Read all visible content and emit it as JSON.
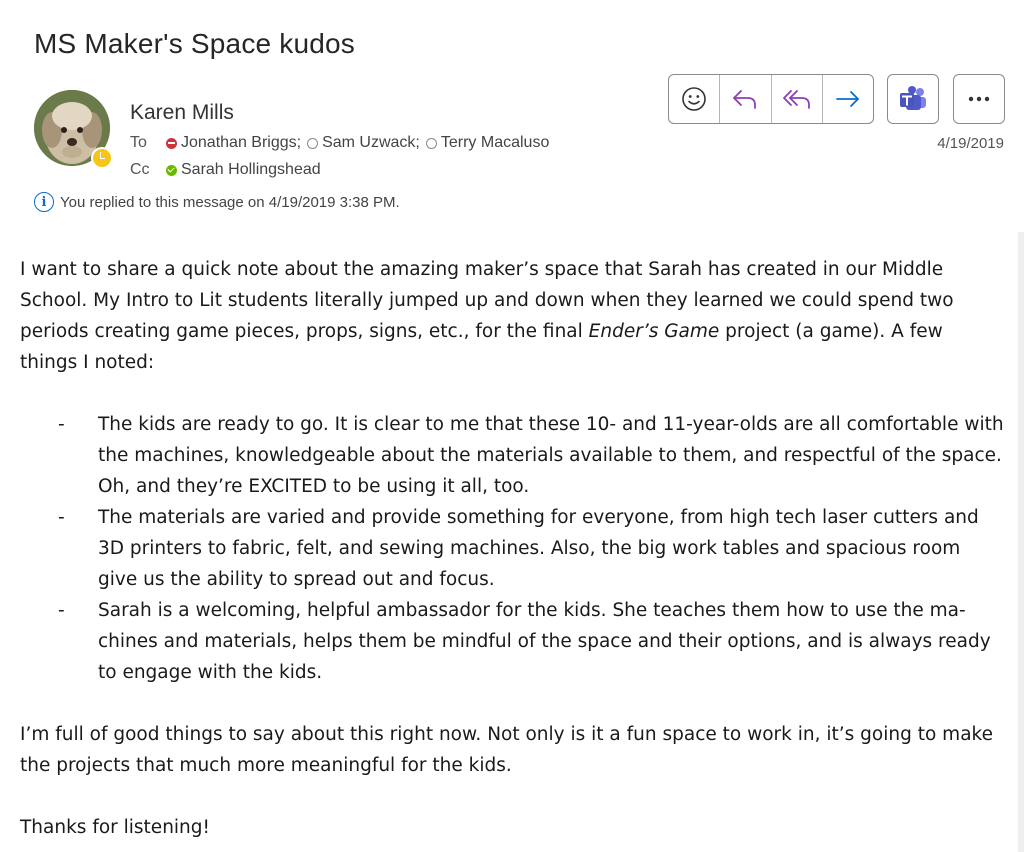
{
  "subject": "MS Maker's Space kudos",
  "sender": {
    "name": "Karen Mills"
  },
  "to_label": "To",
  "cc_label": "Cc",
  "recipients_to": [
    {
      "name": "Jonathan Briggs;",
      "status": "busy"
    },
    {
      "name": "Sam Uzwack;",
      "status": "offline"
    },
    {
      "name": "Terry Macaluso",
      "status": "offline"
    }
  ],
  "recipients_cc": [
    {
      "name": "Sarah Hollingshead",
      "status": "available"
    }
  ],
  "info_text": "You replied to this message on 4/19/2019 3:38 PM.",
  "date": "4/19/2019",
  "toolbar": {
    "actions": [
      "emoji-icon",
      "reply-icon",
      "reply-all-icon",
      "forward-icon"
    ],
    "teams": "teams-icon",
    "more": "more-icon"
  },
  "colors": {
    "accent": "#0a6ccf",
    "reply_purple": "#8a3fb5",
    "busy": "#d13438",
    "available": "#6bb700",
    "away": "#f5c518"
  },
  "body": {
    "intro_1": "I want to share a quick note about the amazing maker’s space that Sarah has created in our Middle School. My Intro to Lit students literally jumped up and down when they learned we could spend two periods creating game pieces, props, signs, etc., for the final ",
    "intro_italic": "Ender’s Game",
    "intro_2": " project (a game). A few things I noted:",
    "bullet_marker": "-",
    "bullets": [
      "The kids are ready to go. It is clear to me that these 10- and 11-year-olds are all comfortable with the machines, knowledgeable about the materials available to them, and respectful of the space. Oh, and they’re EXCITED to be using it all, too.",
      "The materials are varied and provide something for everyone, from high tech laser cutters and 3D printers to fabric, felt, and sewing machines. Also, the big work tables and spacious room give us the ability to spread out and focus.",
      "Sarah is a welcoming, helpful ambassador for the kids. She teaches them how to use the ma­chines and materials, helps them be mindful of the space and their options, and is always ready to engage with the kids."
    ],
    "outro": "I’m full of good things to say about this right now. Not only is it a fun space to work in, it’s going to make the projects that much more meaningful for the kids.",
    "closing": "Thanks for listening!"
  }
}
